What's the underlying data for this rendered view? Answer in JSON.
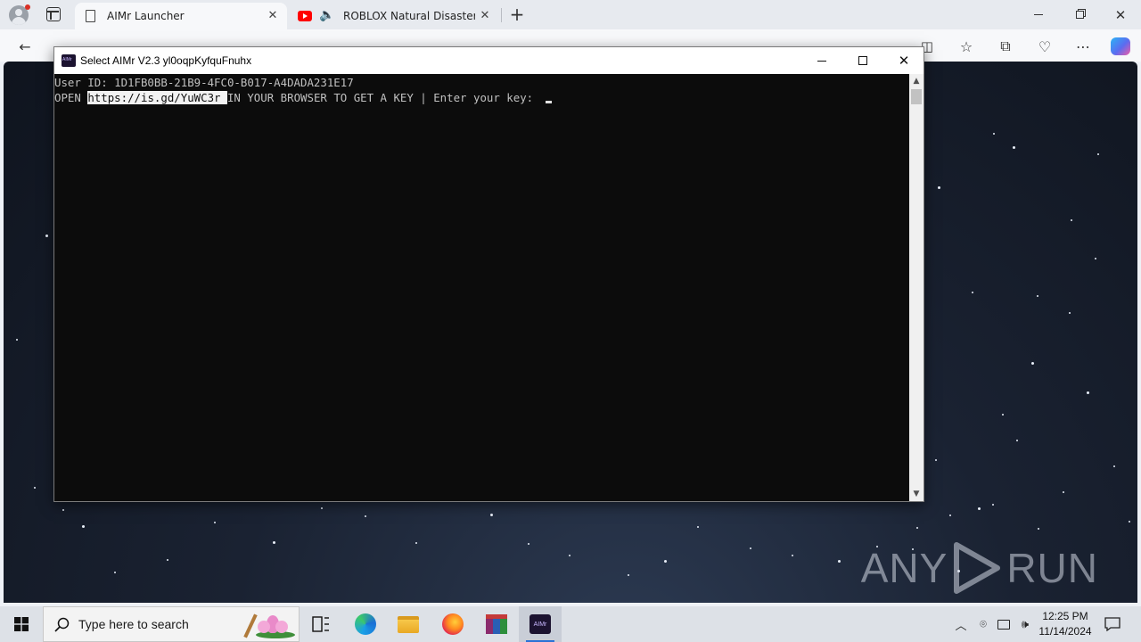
{
  "browser": {
    "tabs": [
      {
        "label": "AIMr Launcher",
        "active": true
      },
      {
        "label": "ROBLOX Natural Disaster Su",
        "active": false
      }
    ]
  },
  "console": {
    "title": "Select AIMr V2.3 yl0oqpKyfquFnuhx",
    "line1": "User ID: 1D1FB0BB-21B9-4FC0-B017-A4DADA231E17",
    "line2_prefix": "OPEN ",
    "line2_url": "https://is.gd/YuWC3r ",
    "line2_suffix": "IN YOUR BROWSER TO GET A KEY | Enter your key: ",
    "app_icon_text": "AIMr"
  },
  "watermark": {
    "text_left": "ANY",
    "text_right": "RUN"
  },
  "taskbar": {
    "search_placeholder": "Type here to search",
    "active_app_label": "AIMr",
    "clock_time": "12:25 PM",
    "clock_date": "11/14/2024"
  },
  "colors": {
    "console_bg": "#0c0c0c",
    "console_text": "#c0c0c0",
    "taskbar_accent": "#2a72d6",
    "youtube_red": "#ff0000"
  }
}
